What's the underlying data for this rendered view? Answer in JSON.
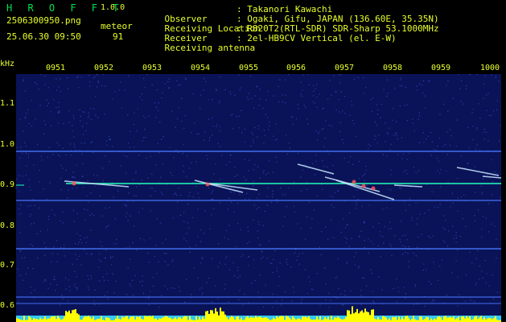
{
  "header": {
    "app_name": "H R O F F T",
    "version": "1.0.0",
    "file_name": "2506300950.png",
    "datetime": "25.06.30 09:50",
    "meteor_label": "meteor",
    "meteor_count": "91",
    "info": [
      {
        "key": "Observer",
        "value": ": Takanori Kawachi"
      },
      {
        "key": "Receiving Location",
        "value": ": Ogaki, Gifu, JAPAN (136.60E, 35.35N)"
      },
      {
        "key": "Receiver",
        "value": ": R820T2(RTL-SDR) SDR-Sharp 53.1000MHz"
      },
      {
        "key": "Receiving antenna",
        "value": ": 2el-HB9CV Vertical (el. E-W)"
      }
    ]
  },
  "axes": {
    "y_unit": "kHz",
    "y_ticks": [
      "1.1",
      "1.0",
      "0.9",
      "0.8",
      "0.7",
      "0.6"
    ],
    "x_ticks": [
      "0951",
      "0952",
      "0953",
      "0954",
      "0955",
      "0956",
      "0957",
      "0958",
      "0959",
      "1000"
    ]
  },
  "colors": {
    "background": "#0a1358",
    "text": "#e8ff2a",
    "title": "#00e14a",
    "carrier": "#22ffbb",
    "stripe": "#4a78ff",
    "level": "#ffff00",
    "level_base": "#33c9ff"
  }
}
